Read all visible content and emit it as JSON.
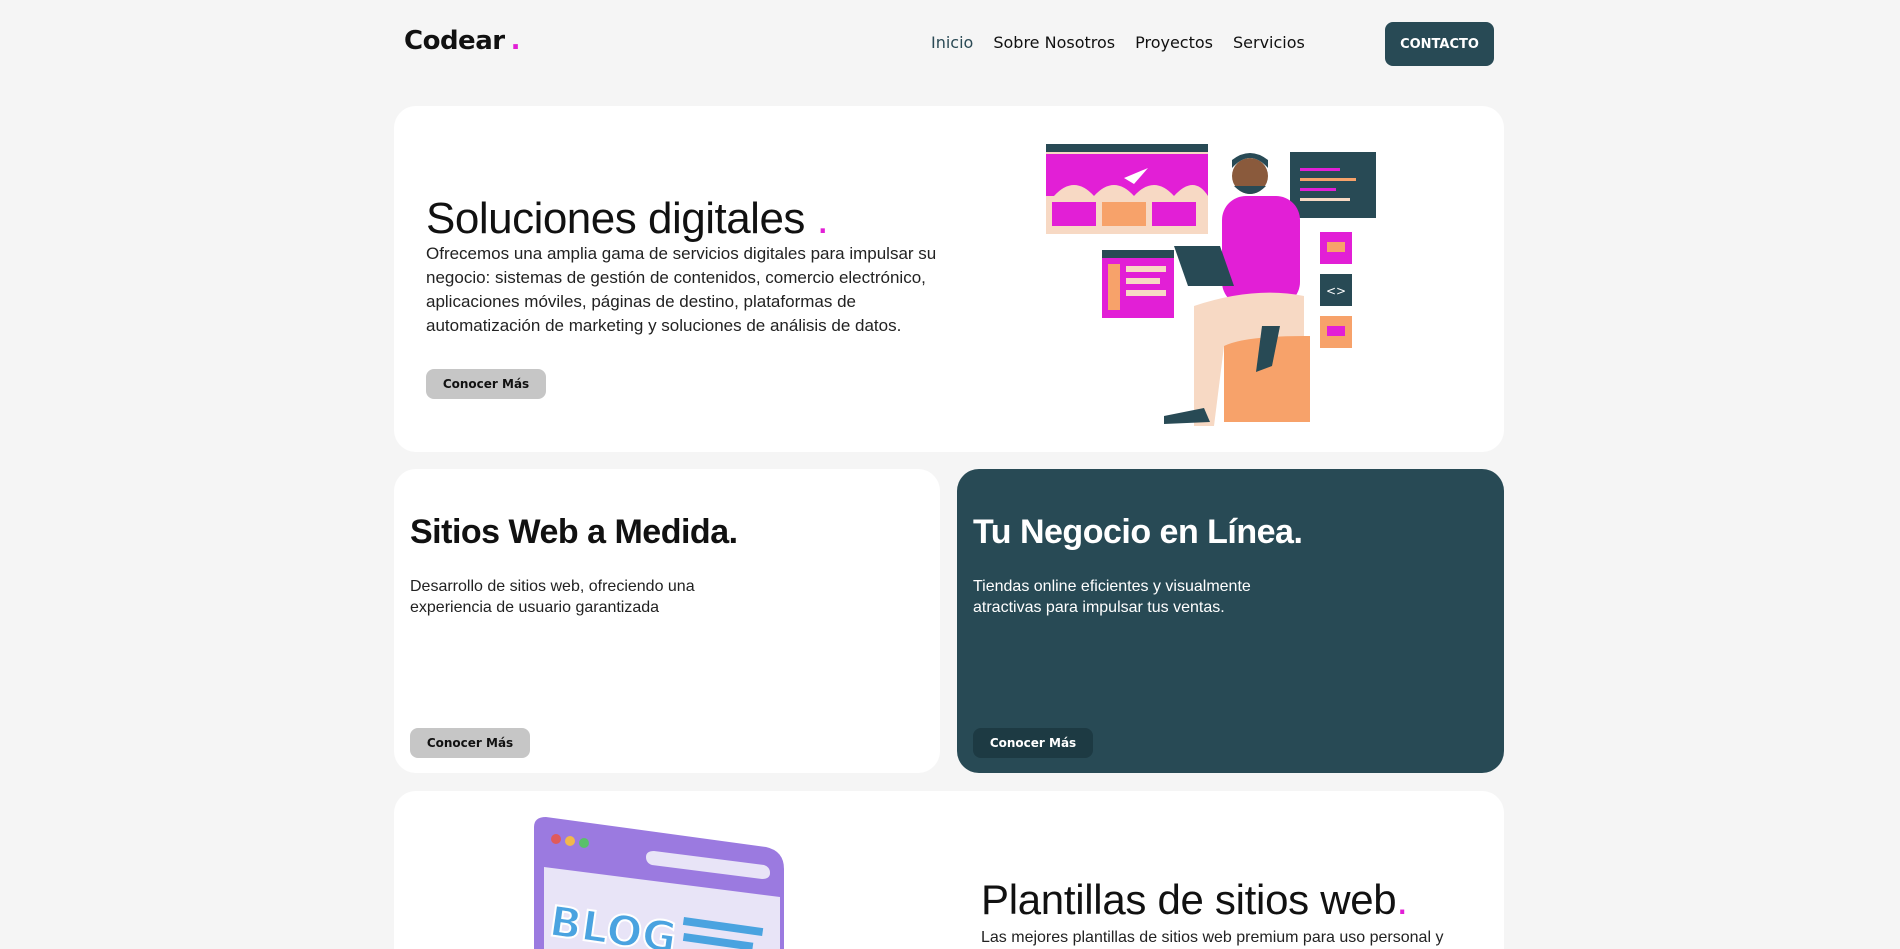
{
  "nav": {
    "logo": "Codear",
    "logo_dot": ".",
    "items": [
      {
        "label": "Inicio",
        "active": true
      },
      {
        "label": "Sobre Nosotros",
        "active": false
      },
      {
        "label": "Proyectos",
        "active": false
      },
      {
        "label": "Servicios",
        "active": false
      }
    ],
    "contact_label": "CONTACTO"
  },
  "hero": {
    "title": "Soluciones digitales",
    "title_dot": ".",
    "description": "Ofrecemos una amplia gama de servicios digitales para impulsar su negocio: sistemas de gestión de contenidos, comercio electrónico, aplicaciones móviles, páginas de destino, plataformas de automatización de marketing y soluciones de análisis de datos.",
    "button": "Conocer Más"
  },
  "card_web": {
    "title": "Sitios Web a Medida.",
    "description": "Desarrollo de sitios web, ofreciendo una experiencia de usuario garantizada",
    "button": "Conocer Más"
  },
  "card_shop": {
    "title": "Tu Negocio en Línea.",
    "description": "Tiendas online eficientes y visualmente atractivas para impulsar tus ventas.",
    "button": "Conocer Más"
  },
  "card_templates": {
    "title": "Plantillas de sitios web",
    "title_dot": ".",
    "description": "Las mejores plantillas de sitios web premium para uso personal y",
    "illustration_text": "BLOG"
  },
  "colors": {
    "accent": "#e21fd6",
    "dark_teal": "#284a55",
    "button_grey": "#c6c6c6",
    "background": "#f5f5f5"
  }
}
